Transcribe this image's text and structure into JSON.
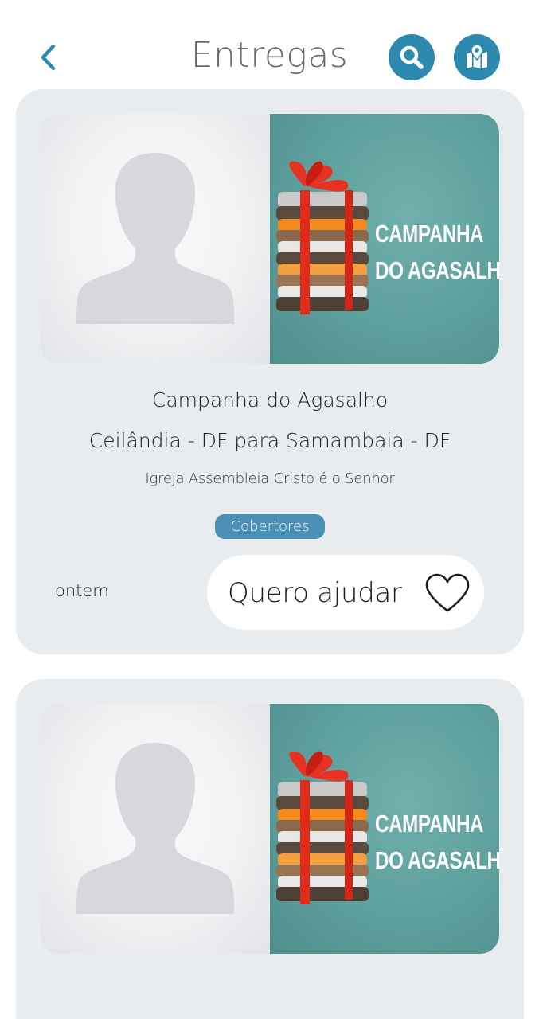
{
  "header": {
    "title": "Entregas",
    "accent_color": "#2e89ae",
    "icons": {
      "back": "chevron-left-icon",
      "search": "search-icon",
      "map": "map-pin-icon"
    }
  },
  "cards": [
    {
      "campaign_image_text": [
        "CAMPANHA",
        "DO AGASALHO"
      ],
      "name": "Campanha do Agasalho",
      "route": "Ceilândia - DF para Samambaia - DF",
      "organization": "Igreja Assembleia Cristo é o Senhor",
      "tag": "Cobertores",
      "time": "ontem",
      "help_label": "Quero ajudar"
    },
    {
      "campaign_image_text": [
        "CAMPANHA",
        "DO AGASALHO"
      ]
    }
  ],
  "colors": {
    "card_background": "#e8ecef",
    "tag_background": "#4a90b6",
    "campaign_background": "#5d9f9c"
  }
}
